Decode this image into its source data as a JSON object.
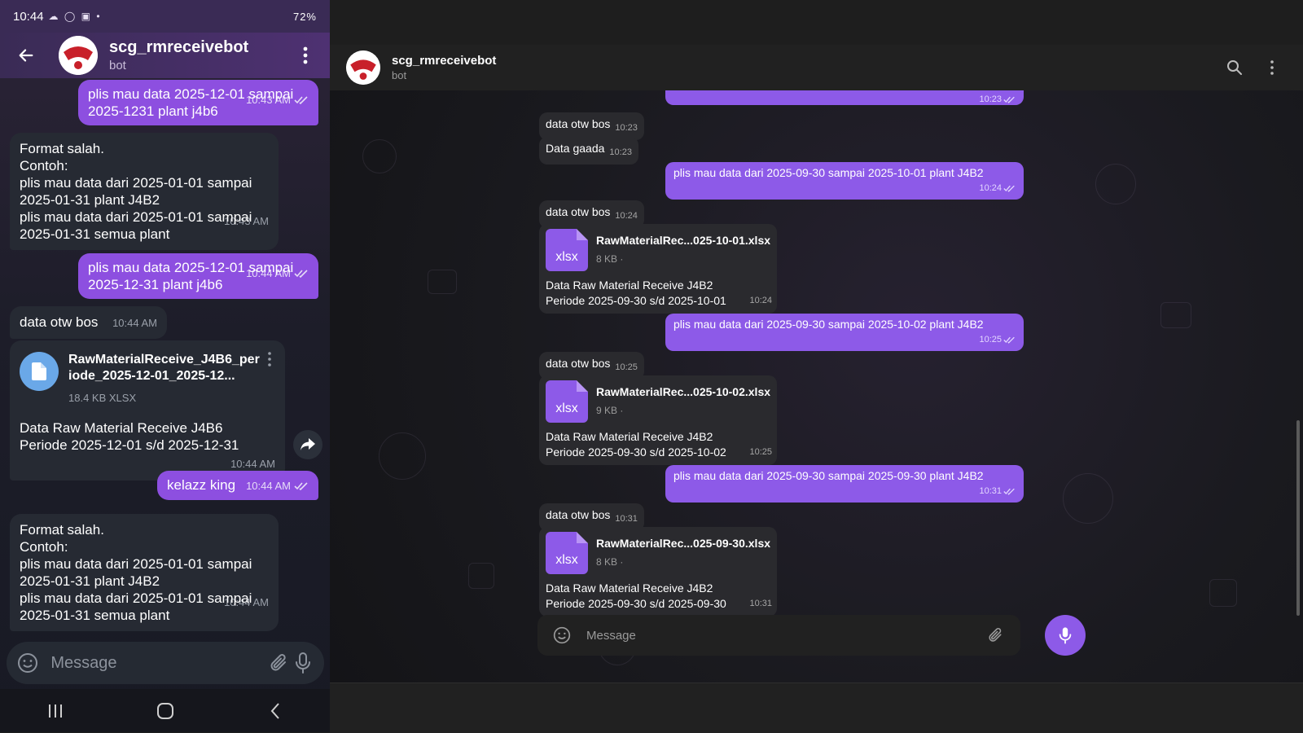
{
  "phone": {
    "status": {
      "time": "10:44",
      "right": "72%"
    },
    "header": {
      "name": "scg_rmreceivebot",
      "subtitle": "bot"
    },
    "messages": {
      "m1": {
        "text": "plis mau data 2025-12-01 sampai\n2025-1231 plant j4b6",
        "time": "10:43 AM"
      },
      "m2": {
        "text": "Format salah.\nContoh:\nplis mau data dari 2025-01-01 sampai\n2025-01-31 plant J4B2\nplis mau data dari 2025-01-01 sampai\n2025-01-31 semua plant",
        "time": "10:43 AM"
      },
      "m3": {
        "text": "plis mau data 2025-12-01 sampai\n2025-12-31 plant j4b6",
        "time": "10:44 AM"
      },
      "m4": {
        "text": "data otw bos",
        "time": "10:44 AM"
      },
      "m5": {
        "file_name": "RawMaterialReceive_J4B6_per\niode_2025-12-01_2025-12...",
        "file_size": "18.4 KB XLSX",
        "caption": "Data Raw Material Receive J4B6\nPeriode 2025-12-01 s/d 2025-12-31",
        "time": "10:44 AM"
      },
      "m6": {
        "text": "kelazz king",
        "time": "10:44 AM"
      },
      "m7": {
        "text": "Format salah.\nContoh:\nplis mau data dari 2025-01-01 sampai\n2025-01-31 plant J4B2\nplis mau data dari 2025-01-01 sampai\n2025-01-31 semua plant",
        "time": "10:44 AM"
      }
    },
    "input": {
      "placeholder": "Message"
    }
  },
  "desktop": {
    "header": {
      "name": "scg_rmreceivebot",
      "subtitle": "bot"
    },
    "messages": {
      "top_out": {
        "time": "10:23"
      },
      "in1": {
        "text": "data otw bos",
        "time": "10:23"
      },
      "in2": {
        "text": "Data gaada",
        "time": "10:23"
      },
      "out1": {
        "text": "plis mau data dari 2025-09-30 sampai 2025-10-01 plant J4B2",
        "time": "10:24"
      },
      "in3": {
        "text": "data otw bos",
        "time": "10:24"
      },
      "file1": {
        "ext": "xlsx",
        "file_name": "RawMaterialRec...025-10-01.xlsx",
        "file_size": "8 KB ·",
        "caption": "Data Raw Material Receive J4B2\nPeriode 2025-09-30 s/d 2025-10-01",
        "time": "10:24"
      },
      "out2": {
        "text": "plis mau data dari 2025-09-30 sampai 2025-10-02 plant J4B2",
        "time": "10:25"
      },
      "in4": {
        "text": "data otw bos",
        "time": "10:25"
      },
      "file2": {
        "ext": "xlsx",
        "file_name": "RawMaterialRec...025-10-02.xlsx",
        "file_size": "9 KB ·",
        "caption": "Data Raw Material Receive J4B2\nPeriode 2025-09-30 s/d 2025-10-02",
        "time": "10:25"
      },
      "out3": {
        "text": "plis mau data dari 2025-09-30 sampai 2025-09-30 plant J4B2",
        "time": "10:31"
      },
      "in5": {
        "text": "data otw bos",
        "time": "10:31"
      },
      "file3": {
        "ext": "xlsx",
        "file_name": "RawMaterialRec...025-09-30.xlsx",
        "file_size": "8 KB ·",
        "caption": "Data Raw Material Receive J4B2\nPeriode 2025-09-30 s/d 2025-09-30",
        "time": "10:31"
      }
    },
    "composer": {
      "placeholder": "Message"
    }
  },
  "colors": {
    "accent": "#8d5ae8",
    "phone_outgoing": "#8d4fe0",
    "incoming": "#2a2a2e",
    "file_icon_phone": "#6aa8e8"
  },
  "icons": [
    "back-arrow-icon",
    "more-vert-icon",
    "double-check-icon",
    "file-icon",
    "share-icon",
    "emoji-icon",
    "attach-icon",
    "mic-icon",
    "search-icon"
  ]
}
